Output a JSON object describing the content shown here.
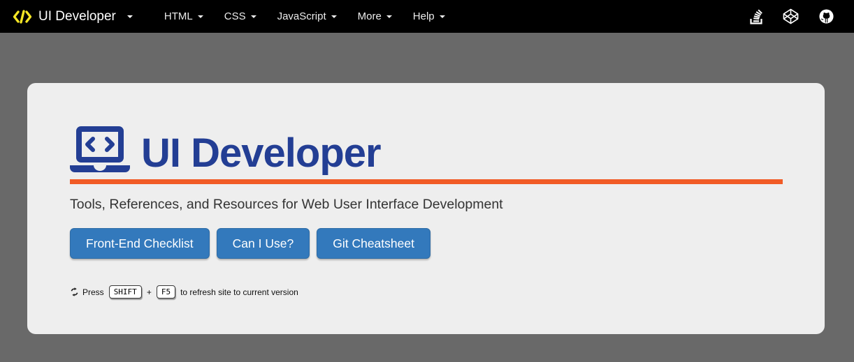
{
  "navbar": {
    "brand": {
      "label": "UI Developer"
    },
    "items": [
      {
        "label": "HTML"
      },
      {
        "label": "CSS"
      },
      {
        "label": "JavaScript"
      },
      {
        "label": "More"
      },
      {
        "label": "Help"
      }
    ],
    "right_icons": [
      {
        "name": "stack-overflow-icon"
      },
      {
        "name": "codepen-icon"
      },
      {
        "name": "github-icon"
      }
    ]
  },
  "main": {
    "title": "UI Developer",
    "subtitle": "Tools, References, and Resources for Web User Interface Development",
    "buttons": [
      {
        "label": "Front-End Checklist"
      },
      {
        "label": "Can I Use?"
      },
      {
        "label": "Git Cheatsheet"
      }
    ],
    "refresh_note": {
      "prefix": "Press",
      "key1": "SHIFT",
      "separator": "+",
      "key2": "F5",
      "suffix": "to refresh site to current version"
    }
  },
  "colors": {
    "navbar_bg": "#000000",
    "page_bg": "#696969",
    "card_bg": "#eeeeee",
    "brand_icon_yellow": "#f5e625",
    "heading_blue": "#233e94",
    "rule_orange": "#f15b26",
    "button_blue": "#3379bc"
  }
}
